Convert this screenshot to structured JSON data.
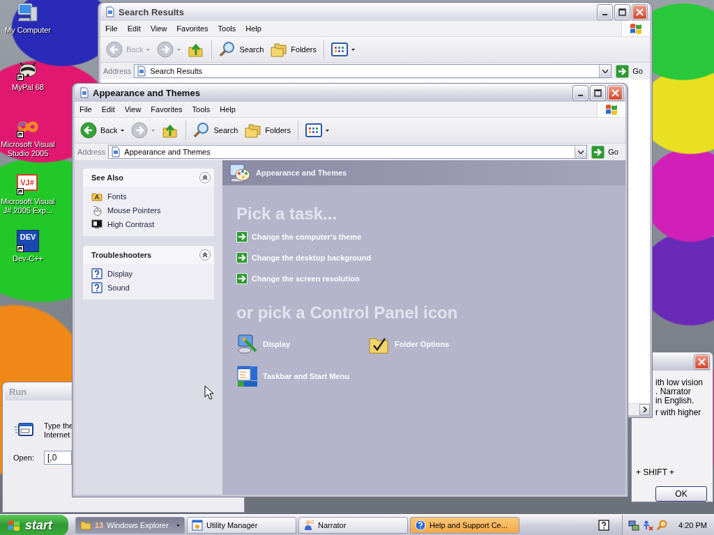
{
  "desktop_icons": [
    {
      "label": "My Computer",
      "kind": "computer",
      "shortcut": false
    },
    {
      "label": "MyPal 68",
      "kind": "animal",
      "shortcut": true
    },
    {
      "label": "Microsoft Visual Studio 2005",
      "kind": "infinity",
      "shortcut": true
    },
    {
      "label": "Microsoft Visual J# 2005 Exp...",
      "kind": "vj",
      "icon_text": "VJ#",
      "shortcut": true
    },
    {
      "label": "Dev-C++",
      "kind": "dev",
      "icon_text": "DEV",
      "shortcut": true
    }
  ],
  "run_dialog": {
    "title": "Run",
    "active": false,
    "prompt": [
      "Type the",
      "Internet"
    ],
    "open_label": "Open:",
    "value": "[,0"
  },
  "narrator_dialog": {
    "lines": [
      "ith low vision",
      ". Narrator",
      "in English.",
      "r with higher"
    ],
    "shortcut_line": "+ SHIFT +",
    "ok": "OK"
  },
  "windows": [
    {
      "kind": "search",
      "title": "Search Results",
      "active": false,
      "menu": [
        "File",
        "Edit",
        "View",
        "Favorites",
        "Tools",
        "Help"
      ],
      "back": {
        "label": "Back",
        "disabled": true
      },
      "search": "Search",
      "folders": "Folders",
      "address_label": "Address",
      "address": "Search Results",
      "go": "Go"
    },
    {
      "kind": "appearance",
      "title": "Appearance and Themes",
      "active": true,
      "menu": [
        "File",
        "Edit",
        "View",
        "Favorites",
        "Tools",
        "Help"
      ],
      "back": {
        "label": "Back",
        "disabled": false
      },
      "search": "Search",
      "folders": "Folders",
      "address_label": "Address",
      "address": "Appearance and Themes",
      "go": "Go",
      "sidebar": [
        {
          "title": "See Also",
          "expanded": true,
          "items": [
            {
              "label": "Fonts",
              "kind": "fonts"
            },
            {
              "label": "Mouse Pointers",
              "kind": "mouse"
            },
            {
              "label": "High Contrast",
              "kind": "contrast"
            }
          ]
        },
        {
          "title": "Troubleshooters",
          "expanded": true,
          "items": [
            {
              "label": "Display",
              "kind": "help"
            },
            {
              "label": "Sound",
              "kind": "help"
            }
          ]
        }
      ],
      "header": "Appearance and Themes",
      "task_heading": "Pick a task...",
      "tasks": [
        "Change the computer's theme",
        "Change the desktop background",
        "Change the screen resolution"
      ],
      "icon_heading": "or pick a Control Panel icon",
      "panel_icons": [
        {
          "label": "Display",
          "kind": "display"
        },
        {
          "label": "Folder Options",
          "kind": "folder"
        },
        {
          "label": "Taskbar and Start Menu",
          "kind": "taskbar"
        }
      ]
    }
  ],
  "taskbar": {
    "start": "start",
    "buttons": [
      {
        "label": "Windows Explorer",
        "count": "13",
        "kind": "folder",
        "selected": true,
        "flashing": false
      },
      {
        "label": "Utility Manager",
        "kind": "utility",
        "selected": false,
        "flashing": false
      },
      {
        "label": "Narrator",
        "kind": "narrator",
        "selected": false,
        "flashing": false
      },
      {
        "label": "Help and Support Ce...",
        "kind": "help",
        "selected": false,
        "flashing": true
      }
    ],
    "clock": "4:20 PM"
  }
}
